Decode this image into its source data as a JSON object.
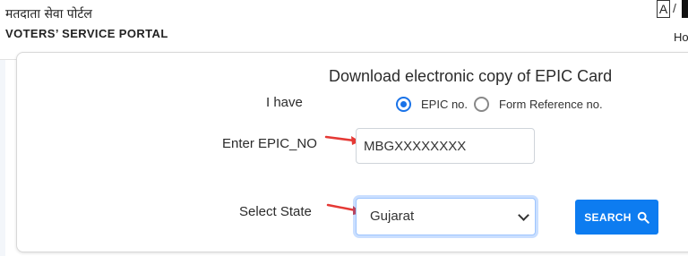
{
  "header": {
    "portal_name_hindi": "मतदाता सेवा पोर्टल",
    "portal_name_english": "VOTERS’ SERVICE PORTAL",
    "font_size_a": "A",
    "font_size_sep": "/",
    "home_link": "Ho"
  },
  "form": {
    "title": "Download electronic copy of EPIC Card",
    "i_have_label": "I have",
    "options": [
      {
        "label": "EPIC no.",
        "selected": true
      },
      {
        "label": "Form Reference no.",
        "selected": false
      }
    ],
    "epic_label": "Enter EPIC_NO",
    "epic_value": "MBGXXXXXXXX",
    "state_label": "Select State",
    "state_value": "Gujarat",
    "search_label": "SEARCH"
  },
  "colors": {
    "accent": "#0d7cf0",
    "arrow": "#e53935",
    "radio_selected": "#1a73e8"
  },
  "icons": [
    "search-icon",
    "chevron-down-icon",
    "arrow-right-icon"
  ]
}
